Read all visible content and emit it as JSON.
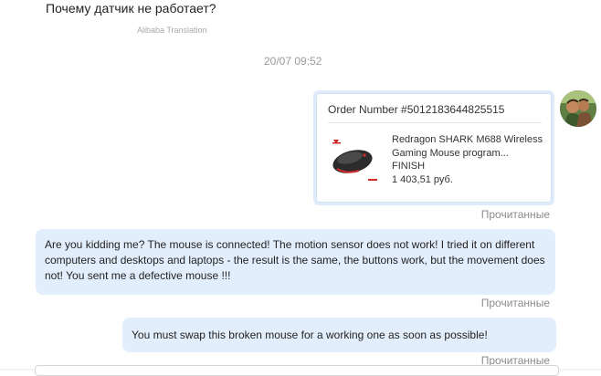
{
  "chat": {
    "translated_message": "Почему датчик не работает?",
    "translation_tag": "Alibaba Translation",
    "date_separator": "20/07 09:52",
    "order_card": {
      "order_number": "Order Number #5012183644825515",
      "product_title": "Redragon SHARK M688 Wireless Gaming Mouse program...",
      "status": "FINISH",
      "price": "1 403,51 руб."
    },
    "read_status_1": "Прочитанные",
    "message_1": "Are you kidding me?  The mouse is connected!  The motion sensor does not work!  I tried it on different computers and desktops and laptops - the result is the same, the buttons work, but the movement does not!  You sent me a defective mouse !!!",
    "read_status_2": "Прочитанные",
    "message_2": "You must swap this broken mouse for a working one as soon as possible!",
    "read_status_3": "Прочитанные"
  },
  "icons": {
    "avatar": "user-avatar-photo",
    "product_image": "gaming-mouse-photo"
  },
  "colors": {
    "bubble_bg": "#e3eefc",
    "card_border": "#dfeafb",
    "read_status": "#8c8c8c",
    "date_text": "#9a9a9a"
  }
}
